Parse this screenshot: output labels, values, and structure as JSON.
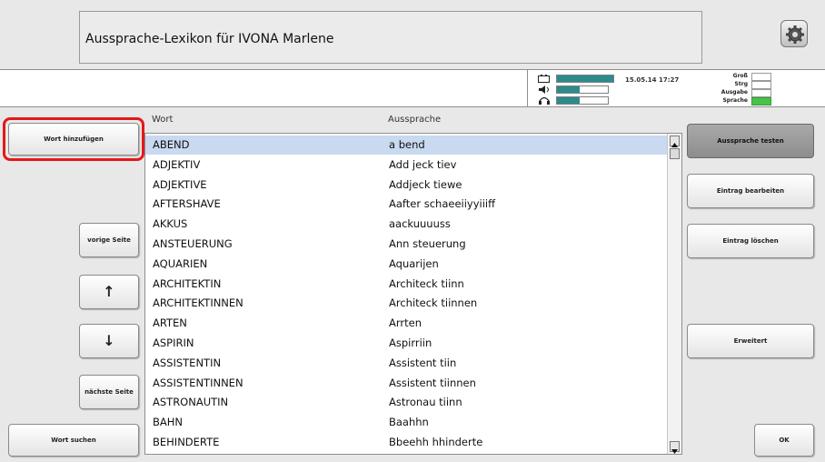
{
  "header": {
    "title": "Aussprache-Lexikon für IVONA Marlene",
    "settings_icon": "gear-icon"
  },
  "status": {
    "datetime": "15.05.14 17:27",
    "meters": [
      {
        "icon": "battery-icon",
        "level": 1.0
      },
      {
        "icon": "speaker-icon",
        "level": 0.45
      },
      {
        "icon": "headphone-icon",
        "level": 0.45
      }
    ],
    "flags": [
      {
        "label": "Groß",
        "on": false
      },
      {
        "label": "Strg",
        "on": false
      },
      {
        "label": "Ausgabe",
        "on": false
      },
      {
        "label": "Sprache",
        "on": true
      }
    ],
    "accent_color": "#2d8b8b",
    "active_color": "#49c24a",
    "highlight_color": "#e3181b"
  },
  "left": {
    "add_word": "Wort hinzufügen",
    "prev_page": "vorige Seite",
    "up_arrow": "↑",
    "down_arrow": "↓",
    "next_page": "nächste Seite",
    "search_word": "Wort suchen"
  },
  "right": {
    "test_pronunciation": "Aussprache testen",
    "edit_entry": "Eintrag bearbeiten",
    "delete_entry": "Eintrag löschen",
    "extended": "Erweitert",
    "ok": "OK"
  },
  "table": {
    "columns": [
      "Wort",
      "Aussprache"
    ],
    "selected_index": 0,
    "rows": [
      {
        "word": "ABEND",
        "pronunciation": "a bend"
      },
      {
        "word": "ADJEKTIV",
        "pronunciation": "Add jeck tiev"
      },
      {
        "word": "ADJEKTIVE",
        "pronunciation": "Addjeck tiewe"
      },
      {
        "word": "AFTERSHAVE",
        "pronunciation": "Aafter schaeeiiyyiiiff"
      },
      {
        "word": "AKKUS",
        "pronunciation": "aackuuuuss"
      },
      {
        "word": "ANSTEUERUNG",
        "pronunciation": "Ann steuerung"
      },
      {
        "word": "AQUARIEN",
        "pronunciation": "Aquarijen"
      },
      {
        "word": "ARCHITEKTIN",
        "pronunciation": "Architeck tiinn"
      },
      {
        "word": "ARCHITEKTINNEN",
        "pronunciation": "Architeck tiinnen"
      },
      {
        "word": "ARTEN",
        "pronunciation": "Arrten"
      },
      {
        "word": "ASPIRIN",
        "pronunciation": "Aspirriin"
      },
      {
        "word": "ASSISTENTIN",
        "pronunciation": "Assistent tiin"
      },
      {
        "word": "ASSISTENTINNEN",
        "pronunciation": "Assistent tiinnen"
      },
      {
        "word": "ASTRONAUTIN",
        "pronunciation": "Astronau tiinn"
      },
      {
        "word": "BAHN",
        "pronunciation": "Baahhn"
      },
      {
        "word": "BEHINDERTE",
        "pronunciation": "Bbeehh hhinderte"
      }
    ]
  }
}
